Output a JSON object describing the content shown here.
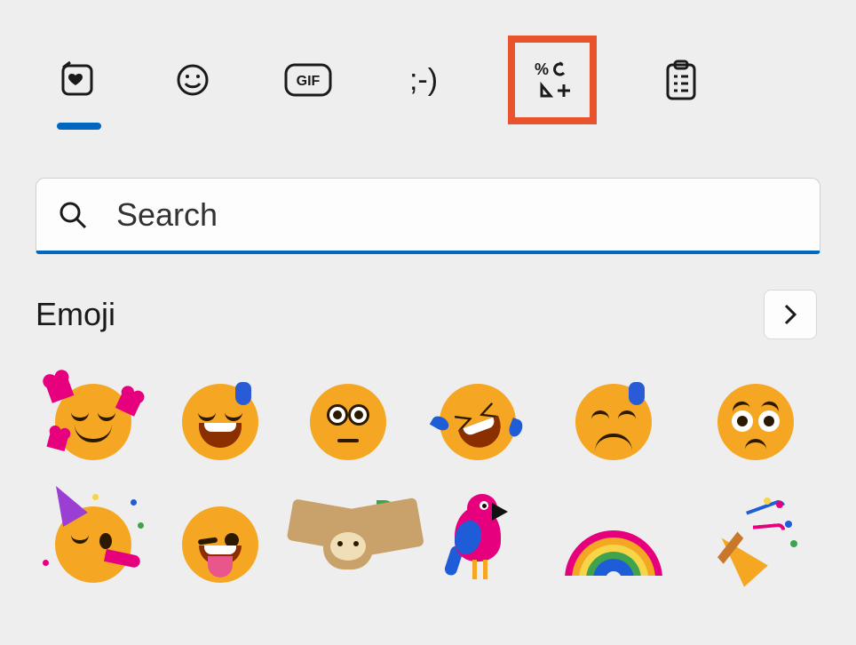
{
  "tabs": {
    "favorites": "Most recently used",
    "emoji": "Emoji",
    "gif": "GIF",
    "kaomoji": ";-)",
    "symbols": "Symbols",
    "clipboard": "Clipboard history"
  },
  "highlight_tab": "symbols",
  "active_tab": "favorites",
  "search": {
    "placeholder": "Search"
  },
  "section": {
    "title": "Emoji"
  },
  "emoji_items": [
    {
      "name": "smiling-face-with-hearts"
    },
    {
      "name": "grinning-face-with-sweat"
    },
    {
      "name": "flushed-face"
    },
    {
      "name": "rolling-on-the-floor-laughing"
    },
    {
      "name": "downcast-face-with-sweat"
    },
    {
      "name": "pleading-face"
    },
    {
      "name": "partying-face"
    },
    {
      "name": "winking-face-with-tongue"
    },
    {
      "name": "sloth"
    },
    {
      "name": "parrot"
    },
    {
      "name": "rainbow"
    },
    {
      "name": "party-popper"
    }
  ],
  "colors": {
    "accent": "#0067c0",
    "highlight": "#e8532e"
  }
}
